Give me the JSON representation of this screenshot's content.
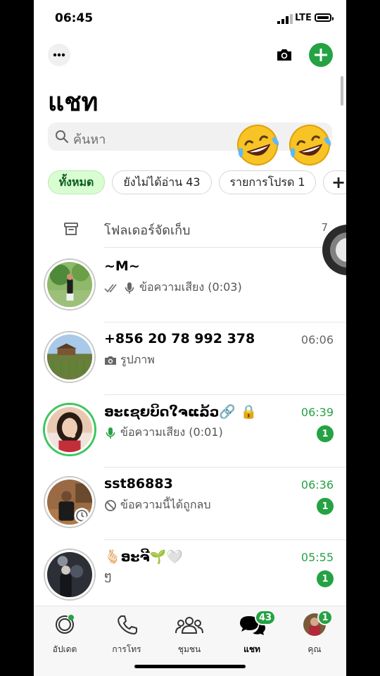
{
  "status_bar": {
    "time": "06:45",
    "network": "LTE"
  },
  "header": {
    "title": "แชท"
  },
  "search": {
    "placeholder": "ค้นหา",
    "emoji_overlay": [
      "face-with-tears-of-joy",
      "face-with-tears-of-joy"
    ]
  },
  "filters": [
    {
      "label": "ทั้งหมด",
      "active": true
    },
    {
      "label": "ยังไม่ได้อ่าน 43",
      "active": false
    },
    {
      "label": "รายการโปรด 1",
      "active": false
    },
    {
      "label": "+",
      "active": false
    }
  ],
  "archived": {
    "label": "โฟลเดอร์จัดเก็บ",
    "count": "7"
  },
  "chats": [
    {
      "name": "~M~",
      "time": "",
      "preview": "ข้อความเสียง (0:03)",
      "preview_icon": "read-ticks-mic",
      "unread": ""
    },
    {
      "name": "+856 20 78 992 378",
      "time": "06:06",
      "preview": "รูปภาพ",
      "preview_icon": "camera",
      "unread": ""
    },
    {
      "name": "ອະເຊຍບິດໃຈແລ້ວ🔗 🔒",
      "time": "06:39",
      "preview": "ข้อความเสียง (0:01)",
      "preview_icon": "mic-green",
      "unread": "1"
    },
    {
      "name": "sst86883",
      "time": "06:36",
      "preview": "ข้อความนี้ได้ถูกลบ",
      "preview_icon": "deleted",
      "unread": "1"
    },
    {
      "name": "🫰🏻ອະຈີ🌱🤍",
      "time": "05:55",
      "preview": "ໆ",
      "preview_icon": "",
      "unread": "1"
    }
  ],
  "tabs": [
    {
      "label": "อัปเดต",
      "icon": "updates-icon",
      "badge": ""
    },
    {
      "label": "การโทร",
      "icon": "phone-icon",
      "badge": ""
    },
    {
      "label": "ชุมชน",
      "icon": "communities-icon",
      "badge": ""
    },
    {
      "label": "แชท",
      "icon": "chats-icon",
      "badge": "43",
      "active": true
    },
    {
      "label": "คุณ",
      "icon": "profile-avatar",
      "badge": "1"
    }
  ],
  "colors": {
    "accent": "#25a244",
    "active_pill_bg": "#d9fdd3"
  }
}
